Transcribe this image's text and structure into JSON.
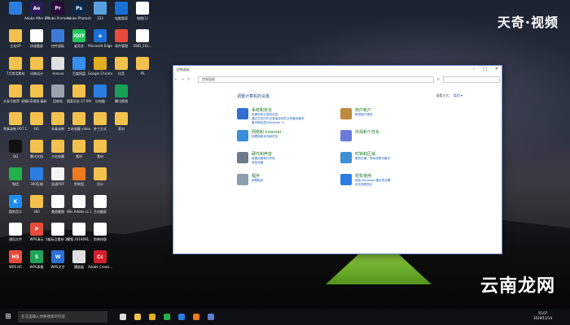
{
  "brand": {
    "top_right": "天奇·视频",
    "bottom_right": "云南龙网"
  },
  "desktop_icons": [
    {
      "label": "",
      "color": "#2a7de1"
    },
    {
      "label": "Adobe After Effects CC",
      "color": "#2a1b5a",
      "glyph": "Ae"
    },
    {
      "label": "Adobe Premiere P...",
      "color": "#2a0a3a",
      "glyph": "Pr"
    },
    {
      "label": "Adobe Photosh...",
      "color": "#0b2a4a",
      "glyph": "Ps"
    },
    {
      "label": "333",
      "color": "#5aa0e0"
    },
    {
      "label": "电脑管家",
      "color": "#1a6fd4"
    },
    {
      "label": "制图(1)",
      "color": "#ffffff"
    },
    {
      "label": "主站OP",
      "color": "#f2c14e"
    },
    {
      "label": "快速截屏",
      "color": "#ffffff"
    },
    {
      "label": "控件面板",
      "color": "#3d7bd8"
    },
    {
      "label": "爱奇艺",
      "color": "#22c55e",
      "glyph": "iQIY"
    },
    {
      "label": "Microsoft Edge",
      "color": "#1d6fd8",
      "glyph": "e"
    },
    {
      "label": "软件管理",
      "color": "#e84b3c"
    },
    {
      "label": "SWD_201...",
      "color": "#ffffff"
    },
    {
      "label": "7月常用素材",
      "color": "#f2c14e"
    },
    {
      "label": "词典设计",
      "color": "#f2c14e"
    },
    {
      "label": "-lenovo",
      "color": "#e0e0e0"
    },
    {
      "label": "百度网盘",
      "color": "#3a8ef0"
    },
    {
      "label": "Google Chrome",
      "color": "#e0b020"
    },
    {
      "label": "抖音",
      "color": "#f2c14e"
    },
    {
      "label": "PS",
      "color": "#f2c14e"
    },
    {
      "label": "头条号推荐 词频图",
      "color": "#f2c14e"
    },
    {
      "label": "天奇视频 精彩",
      "color": "#f2c14e"
    },
    {
      "label": "回收站",
      "color": "#9aa3ad"
    },
    {
      "label": "搜索历史 07.09(1)",
      "color": "#f2c14e"
    },
    {
      "label": "出电脑",
      "color": "#2a7de1"
    },
    {
      "label": "腾讯视频",
      "color": "#18a058"
    },
    {
      "label": "",
      "color": "#000000"
    },
    {
      "label": "完事录制 POT 13",
      "color": "#f2c14e"
    },
    {
      "label": "BG",
      "color": "#f2c14e"
    },
    {
      "label": "杀毒录制",
      "color": "#f2c14e"
    },
    {
      "label": "主站收藏 video",
      "color": "#f2c14e"
    },
    {
      "label": "补丁方式",
      "color": "#f2c14e"
    },
    {
      "label": "素材",
      "color": "#f2c14e"
    },
    {
      "label": "",
      "color": "#000000"
    },
    {
      "label": "QQ",
      "color": "#111111"
    },
    {
      "label": "腾讯文档",
      "color": "#f2c14e"
    },
    {
      "label": "主站收藏",
      "color": "#f2c14e"
    },
    {
      "label": "素材",
      "color": "#f2c14e"
    },
    {
      "label": "素材",
      "color": "#f2c14e"
    },
    {
      "label": "",
      "color": "#000000"
    },
    {
      "label": "",
      "color": "#000000"
    },
    {
      "label": "微信",
      "color": "#22b14c"
    },
    {
      "label": "360压缩",
      "color": "#2a7de1"
    },
    {
      "label": "极速PDF",
      "color": "#f5f5f5"
    },
    {
      "label": "剪映图",
      "color": "#f07a1e"
    },
    {
      "label": "设计",
      "color": "#f2c14e"
    },
    {
      "label": "",
      "color": "#000000"
    },
    {
      "label": "",
      "color": "#000000"
    },
    {
      "label": "酷狗音乐",
      "color": "#1e8ef0",
      "glyph": "K"
    },
    {
      "label": "360",
      "color": "#f2c14e"
    },
    {
      "label": "美图截图",
      "color": "#ffffff"
    },
    {
      "label": "Win Adobe cc 2018 注...",
      "color": "#ffffff"
    },
    {
      "label": "主站截屏",
      "color": "#ffffff"
    },
    {
      "label": "",
      "color": "#000000"
    },
    {
      "label": "",
      "color": "#000000"
    },
    {
      "label": "通用文件",
      "color": "#ffffff"
    },
    {
      "label": "WPS演示",
      "color": "#e84b3c",
      "glyph": "P"
    },
    {
      "label": "5级标注素材 2019091...",
      "color": "#ffffff"
    },
    {
      "label": "视频 2019091...",
      "color": "#ffffff"
    },
    {
      "label": "剪映排版",
      "color": "#ffffff"
    },
    {
      "label": "",
      "color": "#000000"
    },
    {
      "label": "",
      "color": "#000000"
    },
    {
      "label": "WPS H5",
      "color": "#e84b3c",
      "glyph": "H5"
    },
    {
      "label": "WPS表格",
      "color": "#22a35a",
      "glyph": "S"
    },
    {
      "label": "WPS文字",
      "color": "#2a6fd4",
      "glyph": "W"
    },
    {
      "label": "播放器",
      "color": "#e0e0e0"
    },
    {
      "label": "Adobe Creati...",
      "color": "#d4202a",
      "glyph": "Cc"
    }
  ],
  "window": {
    "title": "控制面板",
    "breadcrumb": "控制面板",
    "search_placeholder": "",
    "heading": "调整计算机的设置",
    "view_label": "查看方式：",
    "view_value": "类别 ▾",
    "items_left": [
      {
        "title": "系统和安全",
        "links": [
          "查看你的计算机状态",
          "通过文件历史记录保存你的文件备份副本",
          "备份和还原(Windows 7)"
        ],
        "color": "#2f6fd0"
      },
      {
        "title": "网络和 Internet",
        "links": [
          "查看网络状态和任务"
        ],
        "color": "#3b8ed8"
      },
      {
        "title": "硬件和声音",
        "links": [
          "查看设备和打印机",
          "添加设备"
        ],
        "color": "#6b7b8c"
      },
      {
        "title": "程序",
        "links": [
          "卸载程序"
        ],
        "color": "#8aa0b0"
      }
    ],
    "items_right": [
      {
        "title": "用户帐户",
        "links": [
          "更改帐户类型"
        ],
        "color": "#c08a40"
      },
      {
        "title": "外观和个性化",
        "links": [],
        "color": "#6a7bd8"
      },
      {
        "title": "时钟和区域",
        "links": [
          "更改日期、时间或数字格式"
        ],
        "color": "#3d8fd4"
      },
      {
        "title": "轻松使用",
        "links": [
          "使用 Windows 建议的设置",
          "优化视频显示"
        ],
        "color": "#2a7de1"
      }
    ]
  },
  "taskbar": {
    "start_glyph": "⊞",
    "search_placeholder": "在这里输入你要搜索的内容",
    "apps": [
      {
        "name": "task-view",
        "color": "#dddddd"
      },
      {
        "name": "explorer",
        "color": "#f2c14e"
      },
      {
        "name": "chrome",
        "color": "#e0b020"
      },
      {
        "name": "wechat",
        "color": "#22b14c"
      },
      {
        "name": "app",
        "color": "#2a7de1"
      },
      {
        "name": "app2",
        "color": "#f07a1e"
      },
      {
        "name": "control",
        "color": "#5a7fd0"
      }
    ],
    "time": "15:07",
    "date": "2019/11/14"
  }
}
